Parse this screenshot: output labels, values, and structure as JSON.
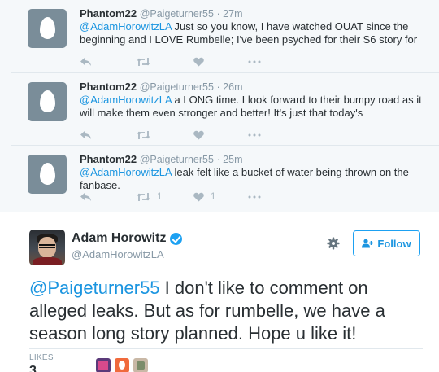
{
  "replies": [
    {
      "name": "Phantom22",
      "handle": "@Paigeturner55",
      "time": "· 27m",
      "mention": "@AdamHorowitzLA",
      "text": " Just so you know, I have watched OUAT since the beginning and I LOVE Rumbelle; I've been psyched for their S6 story for",
      "retweets": "",
      "likes": ""
    },
    {
      "name": "Phantom22",
      "handle": "@Paigeturner55",
      "time": "· 26m",
      "mention": "@AdamHorowitzLA",
      "text": " a LONG time. I look forward to their bumpy road as it will make them even stronger and better! It's just that today's",
      "retweets": "",
      "likes": ""
    },
    {
      "name": "Phantom22",
      "handle": "@Paigeturner55",
      "time": "· 25m",
      "mention": "@AdamHorowitzLA",
      "text": " leak felt like a bucket of water being thrown on the fanbase.",
      "retweets": "1",
      "likes": "1"
    }
  ],
  "main_tweet": {
    "name": "Adam Horowitz",
    "handle": "@AdamHorowitzLA",
    "follow_label": "Follow",
    "mention": "@Paigeturner55",
    "text": " I don't like to comment on alleged leaks.  But as for rumbelle, we have a season long story planned.  Hope u like it!",
    "likes_label": "LIKES",
    "likes_count": "3"
  },
  "icons": [
    "reply-icon",
    "retweet-icon",
    "like-icon",
    "more-icon",
    "verified-icon",
    "gear-icon",
    "follow-icon"
  ],
  "colors": {
    "link": "#1b95e0",
    "muted": "#8899a6",
    "action": "#aab8c2",
    "thread_bg": "#f5f8fa",
    "verified": "#1da1f2"
  }
}
